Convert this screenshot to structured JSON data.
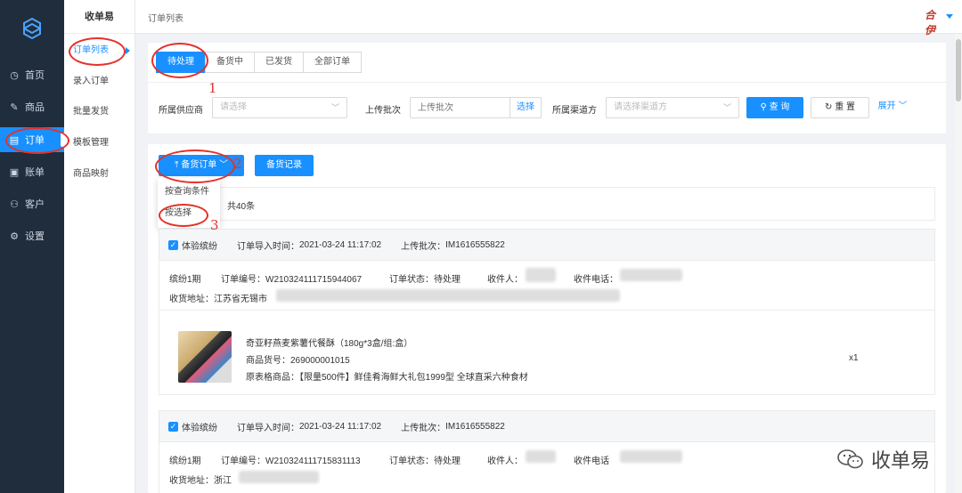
{
  "app": {
    "name": "收单易"
  },
  "nav": {
    "items": [
      {
        "label": "首页",
        "icon": "◷"
      },
      {
        "label": "商品",
        "icon": "✎"
      },
      {
        "label": "订单",
        "icon": "▤"
      },
      {
        "label": "账单",
        "icon": "▣"
      },
      {
        "label": "客户",
        "icon": "⚇"
      },
      {
        "label": "设置",
        "icon": "⚙"
      }
    ]
  },
  "sub_nav": {
    "title": "收单易",
    "items": [
      "订单列表",
      "录入订单",
      "批量发货",
      "模板管理",
      "商品映射"
    ]
  },
  "header": {
    "breadcrumb": "订单列表",
    "user_seal": "合伊"
  },
  "tabs": [
    "待处理",
    "备货中",
    "已发货",
    "全部订单"
  ],
  "filters": {
    "supplier_label": "所属供应商",
    "supplier_placeholder": "请选择",
    "batch_label": "上传批次",
    "batch_placeholder": "上传批次",
    "batch_select_button": "选择",
    "channel_label": "所属渠道方",
    "channel_placeholder": "请选择渠道方",
    "query_button": "查 询",
    "reset_button": "重 置",
    "expand_link": "展开"
  },
  "actions": {
    "stock_button": "备货订单",
    "record_button": "备货记录",
    "dropdown": [
      "按查询条件",
      "按选择"
    ],
    "total_text": "共40条"
  },
  "groups": [
    {
      "channel": "体验缤纷",
      "import_label": "订单导入时间：",
      "import_time": "2021-03-24 11:17:02",
      "batch_label": "上传批次：",
      "batch": "IM1616555822",
      "orders": [
        {
          "period": "缤纷1期",
          "order_no_label": "订单编号：",
          "order_no": "W210324111715944067",
          "status_label": "订单状态：",
          "status": "待处理",
          "receiver_label": "收件人：",
          "phone_label": "收件电话：",
          "address_label": "收货地址：",
          "address": "江苏省无锡市",
          "product": {
            "name": "奇亚籽燕麦紫薯代餐酥（180g*3盒/组:盒）",
            "sku_label": "商品货号：",
            "sku": "269000001015",
            "origin_label": "原表格商品：",
            "origin": "【限量500件】鲜佳肴海鲜大礼包1999型 全球直采六种食材",
            "qty": "x1"
          }
        }
      ]
    },
    {
      "channel": "体验缤纷",
      "import_label": "订单导入时间：",
      "import_time": "2021-03-24 11:17:02",
      "batch_label": "上传批次：",
      "batch": "IM1616555822",
      "orders": [
        {
          "period": "缤纷1期",
          "order_no_label": "订单编号：",
          "order_no": "W210324111715831113",
          "status_label": "订单状态：",
          "status": "待处理",
          "receiver_label": "收件人：",
          "phone_label": "收件电话",
          "address_label": "收货地址：",
          "address": "浙江"
        }
      ]
    }
  ],
  "annotations": [
    "1",
    "2",
    "3"
  ],
  "watermark": "收单易",
  "colors": {
    "primary": "#1890ff",
    "sidebar": "#1f2d3d",
    "annotation": "#e4312b"
  }
}
